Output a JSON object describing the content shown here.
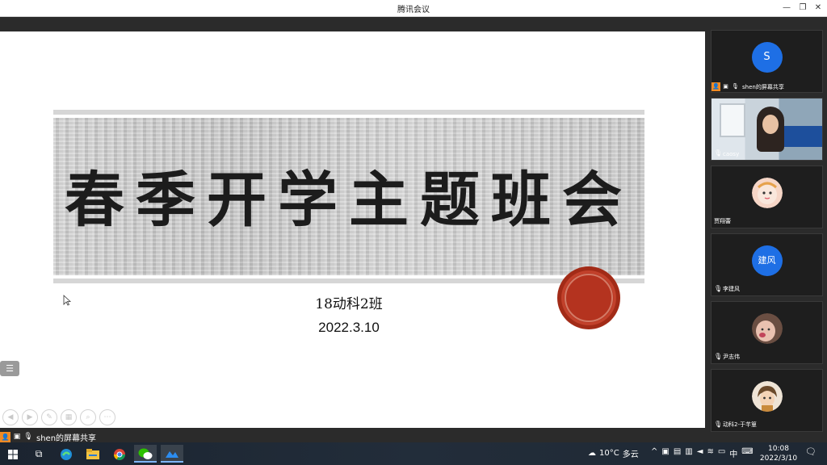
{
  "window": {
    "title": "腾讯会议",
    "minimize_glyph": "—",
    "restore_glyph": "❐",
    "close_glyph": "✕"
  },
  "slide": {
    "title": "春季开学主题班会",
    "class_name": "18动科2班",
    "date": "2022.3.10"
  },
  "share_bar": {
    "label": "shen的屏幕共享"
  },
  "participants": [
    {
      "name": "shen的屏幕共享",
      "avatar_text": "S",
      "avatar_color": "#1e6fe5",
      "type": "initial",
      "sharing": true
    },
    {
      "name": "caosy",
      "type": "camera"
    },
    {
      "name": "贾翔蕾",
      "type": "photo",
      "avatar_color": "#f1c9b5"
    },
    {
      "name": "李建风",
      "avatar_text": "建风",
      "avatar_color": "#1e6fe5",
      "type": "initial"
    },
    {
      "name": "尹志伟",
      "type": "photo",
      "avatar_color": "#e9b7a6"
    },
    {
      "name": "动科2-于芊篁",
      "type": "photo",
      "avatar_color": "#d9b48a"
    }
  ],
  "taskbar": {
    "weather_temp": "10°C",
    "weather_desc": "多云",
    "ime": "中",
    "time": "10:08",
    "date": "2022/3/10",
    "notifications": "1",
    "icons": [
      "windows-icon",
      "task-view-icon",
      "edge-icon",
      "file-explorer-icon",
      "chrome-icon",
      "wechat-icon",
      "tencent-meeting-icon"
    ]
  }
}
